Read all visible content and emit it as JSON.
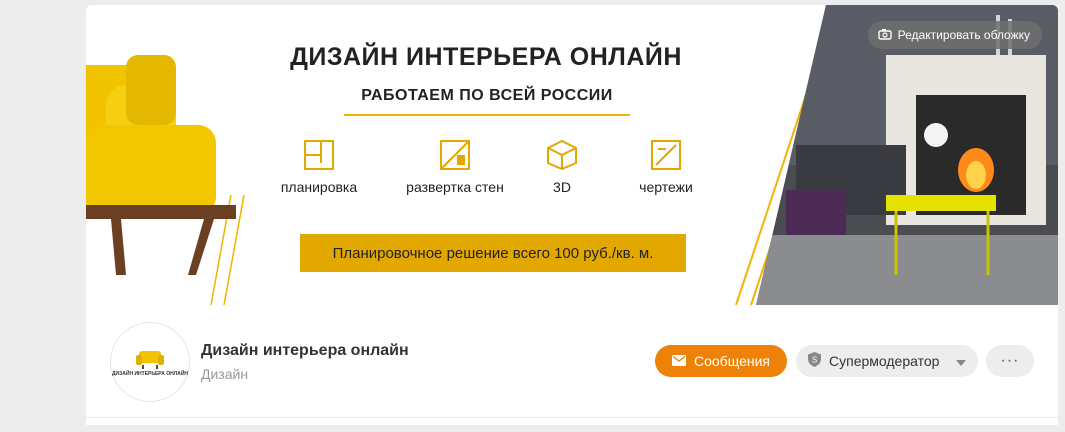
{
  "cover": {
    "edit_label": "Редактировать обложку",
    "title": "ДИЗАЙН ИНТЕРЬЕРА ОНЛАЙН",
    "subtitle": "РАБОТАЕМ ПО ВСЕЙ РОССИИ",
    "features": [
      {
        "label": "планировка",
        "icon": "floorplan-icon"
      },
      {
        "label": "развертка стен",
        "icon": "wall-layout-icon"
      },
      {
        "label": "3D",
        "icon": "cube-3d-icon"
      },
      {
        "label": "чертежи",
        "icon": "drawings-icon"
      }
    ],
    "promo": "Планировочное решение всего 100 руб./кв. м.",
    "accent_color": "#e3a800"
  },
  "group": {
    "avatar_text": "ДИЗАЙН ИНТЕРЬЕРА ОНЛАЙН",
    "name": "Дизайн интерьера онлайн",
    "category": "Дизайн"
  },
  "actions": {
    "messages_label": "Сообщения",
    "role_label": "Супермодератор",
    "more_label": "···",
    "messages_color": "#ee8208"
  }
}
